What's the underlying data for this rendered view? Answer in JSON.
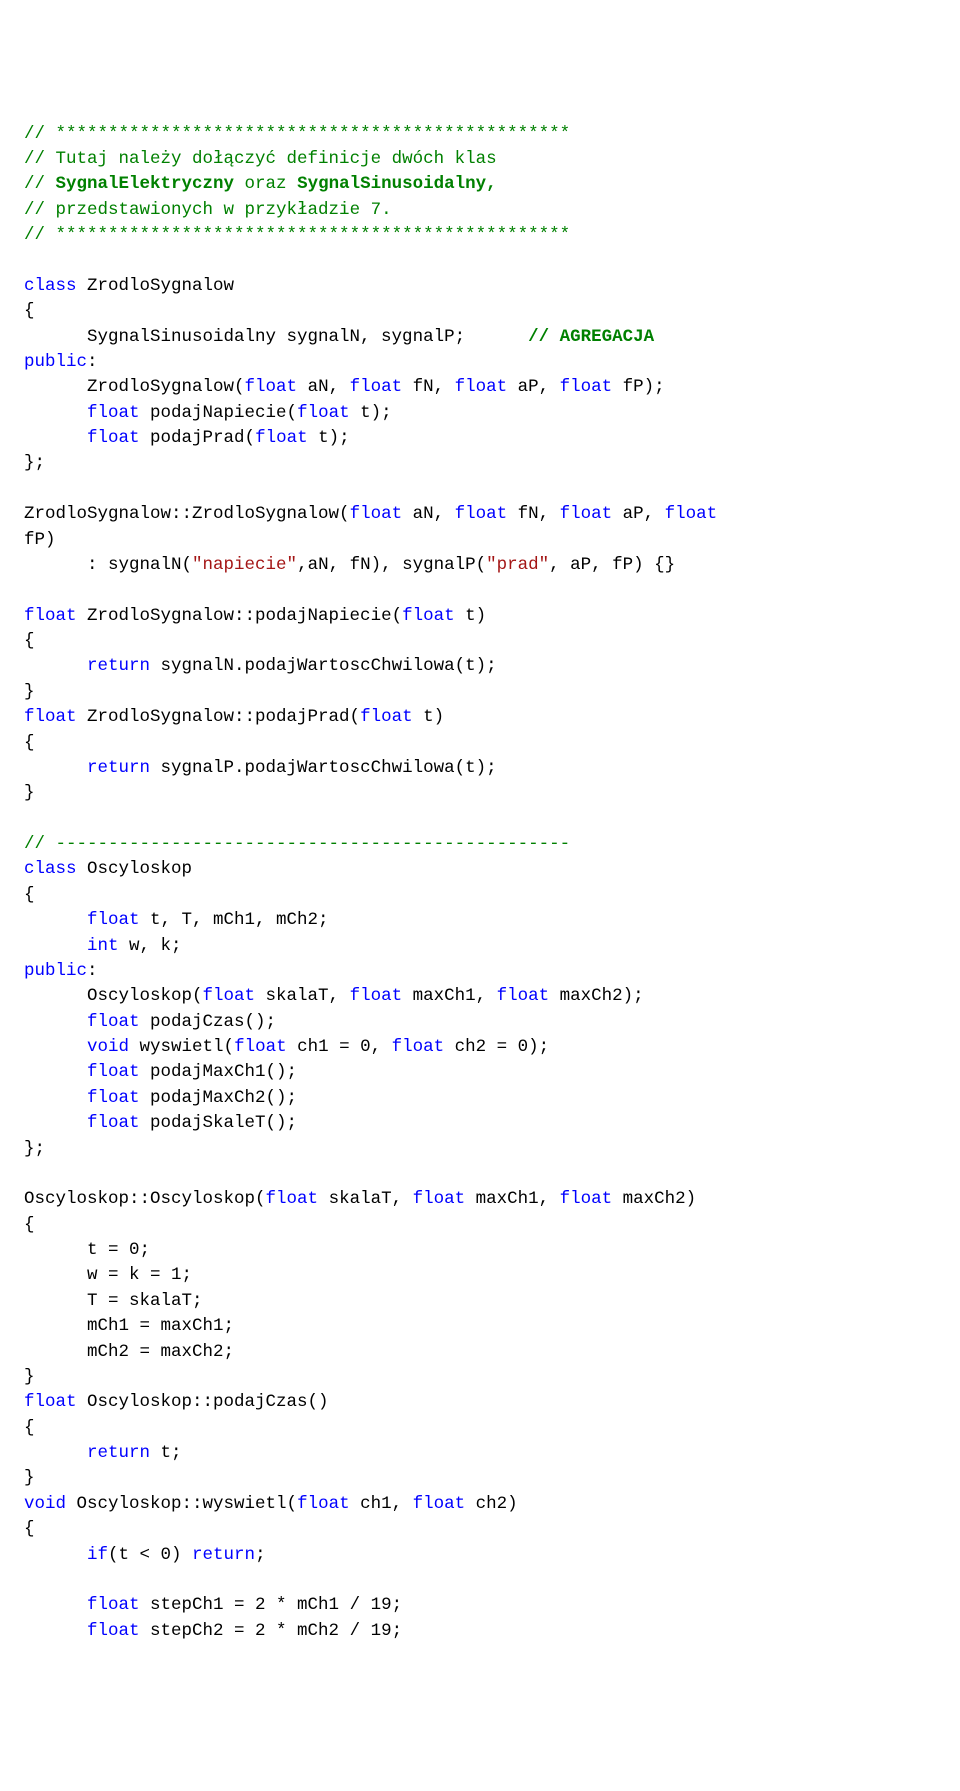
{
  "code": {
    "l1": {
      "a": "// ",
      "b": "*************************************************"
    },
    "l2": {
      "a": "// ",
      "b": "Tutaj należy dołączyć definicje dwóch klas"
    },
    "l3": {
      "a": "// ",
      "b": "SygnalElektryczny",
      "c": " oraz ",
      "d": "SygnalSinusoidalny,"
    },
    "l4": {
      "a": "// ",
      "b": "przedstawionych w przykładzie 7."
    },
    "l5": {
      "a": "// ",
      "b": "*************************************************"
    },
    "l6": {
      "a": "class",
      "b": " ZrodloSygnalow"
    },
    "l7": {
      "a": "{"
    },
    "l8": {
      "a": "      SygnalSinusoidalny sygnalN, sygnalP;      ",
      "b": "// AGREGACJA"
    },
    "l9": {
      "a": "public",
      "b": ":"
    },
    "l10": {
      "a": "      ZrodloSygnalow(",
      "b": "float",
      "c": " aN, ",
      "d": "float",
      "e": " fN, ",
      "f": "float",
      "g": " aP, ",
      "h": "float",
      "i": " fP);"
    },
    "l11": {
      "a": "      ",
      "b": "float",
      "c": " podajNapiecie(",
      "d": "float",
      "e": " t);"
    },
    "l12": {
      "a": "      ",
      "b": "float",
      "c": " podajPrad(",
      "d": "float",
      "e": " t);"
    },
    "l13": {
      "a": "};"
    },
    "l14": {
      "a": "ZrodloSygnalow::ZrodloSygnalow(",
      "b": "float",
      "c": " aN, ",
      "d": "float",
      "e": " fN, ",
      "f": "float",
      "g": " aP, ",
      "h": "float"
    },
    "l15": {
      "a": "fP)"
    },
    "l16": {
      "a": "      : sygnalN(",
      "b": "\"napiecie\"",
      "c": ",aN, fN), sygnalP(",
      "d": "\"prad\"",
      "e": ", aP, fP) {}"
    },
    "l17": {
      "a": "float",
      "b": " ZrodloSygnalow::podajNapiecie(",
      "c": "float",
      "d": " t)"
    },
    "l18": {
      "a": "{"
    },
    "l19": {
      "a": "      ",
      "b": "return",
      "c": " sygnalN.podajWartoscChwilowa(t);"
    },
    "l20": {
      "a": "}"
    },
    "l21": {
      "a": "float",
      "b": " ZrodloSygnalow::podajPrad(",
      "c": "float",
      "d": " t)"
    },
    "l22": {
      "a": "{"
    },
    "l23": {
      "a": "      ",
      "b": "return",
      "c": " sygnalP.podajWartoscChwilowa(t);"
    },
    "l24": {
      "a": "}"
    },
    "l25": {
      "a": "// -------------------------------------------------"
    },
    "l26": {
      "a": "class",
      "b": " Oscyloskop"
    },
    "l27": {
      "a": "{"
    },
    "l28": {
      "a": "      ",
      "b": "float",
      "c": " t, T, mCh1, mCh2;"
    },
    "l29": {
      "a": "      ",
      "b": "int",
      "c": " w, k;"
    },
    "l30": {
      "a": "public",
      "b": ":"
    },
    "l31": {
      "a": "      Oscyloskop(",
      "b": "float",
      "c": " skalaT, ",
      "d": "float",
      "e": " maxCh1, ",
      "f": "float",
      "g": " maxCh2);"
    },
    "l32": {
      "a": "      ",
      "b": "float",
      "c": " podajCzas();"
    },
    "l33": {
      "a": "      ",
      "b": "void",
      "c": " wyswietl(",
      "d": "float",
      "e": " ch1 = 0, ",
      "f": "float",
      "g": " ch2 = 0);"
    },
    "l34": {
      "a": "      ",
      "b": "float",
      "c": " podajMaxCh1();"
    },
    "l35": {
      "a": "      ",
      "b": "float",
      "c": " podajMaxCh2();"
    },
    "l36": {
      "a": "      ",
      "b": "float",
      "c": " podajSkaleT();"
    },
    "l37": {
      "a": "};"
    },
    "l38": {
      "a": "Oscyloskop::Oscyloskop(",
      "b": "float",
      "c": " skalaT, ",
      "d": "float",
      "e": " maxCh1, ",
      "f": "float",
      "g": " maxCh2)"
    },
    "l39": {
      "a": "{"
    },
    "l40": {
      "a": "      t = 0;"
    },
    "l41": {
      "a": "      w = k = 1;"
    },
    "l42": {
      "a": "      T = skalaT;"
    },
    "l43": {
      "a": "      mCh1 = maxCh1;"
    },
    "l44": {
      "a": "      mCh2 = maxCh2;"
    },
    "l45": {
      "a": "}"
    },
    "l46": {
      "a": "float",
      "b": " Oscyloskop::podajCzas()"
    },
    "l47": {
      "a": "{"
    },
    "l48": {
      "a": "      ",
      "b": "return",
      "c": " t;"
    },
    "l49": {
      "a": "}"
    },
    "l50": {
      "a": "void",
      "b": " Oscyloskop::wyswietl(",
      "c": "float",
      "d": " ch1, ",
      "e": "float",
      "f": " ch2)"
    },
    "l51": {
      "a": "{"
    },
    "l52": {
      "a": "      ",
      "b": "if",
      "c": "(t < 0) ",
      "d": "return",
      "e": ";"
    },
    "l53": {
      "a": "      ",
      "b": "float",
      "c": " stepCh1 = 2 * mCh1 / 19;"
    },
    "l54": {
      "a": "      ",
      "b": "float",
      "c": " stepCh2 = 2 * mCh2 / 19;"
    }
  }
}
